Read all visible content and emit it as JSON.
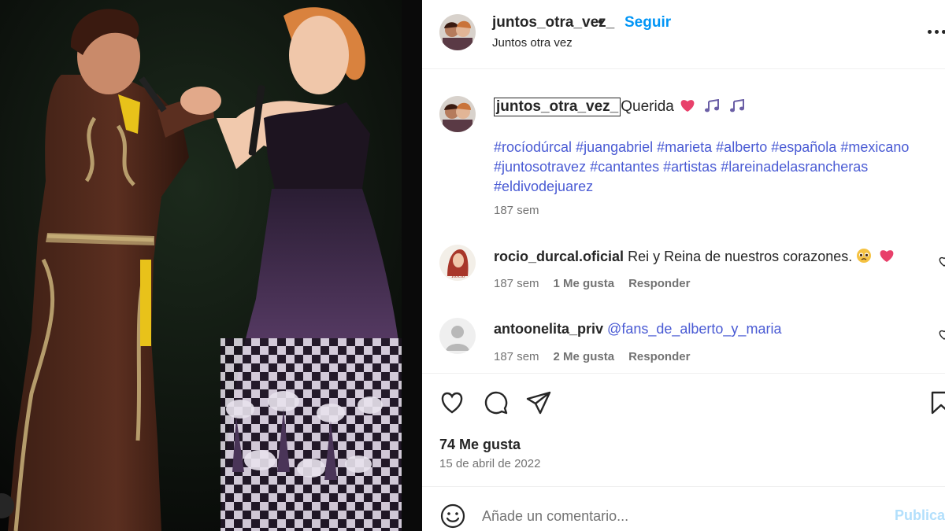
{
  "post": {
    "username": "juntos_otra_vez_",
    "separator": "•",
    "follow_label": "Seguir",
    "subtitle": "Juntos otra vez",
    "more_icon": "more-horizontal-icon"
  },
  "caption": {
    "username": "juntos_otra_vez_",
    "text": "Querida",
    "emojis": [
      "heart-emoji",
      "music-notes-emoji",
      "music-notes-emoji"
    ],
    "hashtags": [
      "#rocíodúrcal",
      "#juangabriel",
      "#marieta",
      "#alberto",
      "#española",
      "#mexicano",
      "#juntosotravez",
      "#cantantes",
      "#artistas",
      "#lareinadelasrancheras",
      "#eldivodejuarez"
    ],
    "time": "187 sem"
  },
  "comments": [
    {
      "username": "rocio_durcal.oficial",
      "text": "Rei y Reina de nuestros corazones.",
      "emojis": [
        "pleading-face-emoji",
        "heart-emoji"
      ],
      "time": "187 sem",
      "likes": "1 Me gusta",
      "reply_label": "Responder"
    },
    {
      "username": "antoonelita_priv",
      "mention": "@fans_de_alberto_y_maria",
      "time": "187 sem",
      "likes": "2 Me gusta",
      "reply_label": "Responder"
    }
  ],
  "actions": {
    "icons": [
      "heart-icon",
      "comment-icon",
      "share-icon",
      "bookmark-icon"
    ],
    "likes_count": "74 Me gusta",
    "date": "15 de abril de 2022"
  },
  "comment_box": {
    "placeholder": "Añade un comentario...",
    "publish_label": "Publicar"
  },
  "colors": {
    "link_blue": "#0095f6",
    "hashtag_blue": "#4a5bd4",
    "muted_text": "#737373",
    "text": "#262626",
    "publish_disabled": "#b2dffc"
  }
}
